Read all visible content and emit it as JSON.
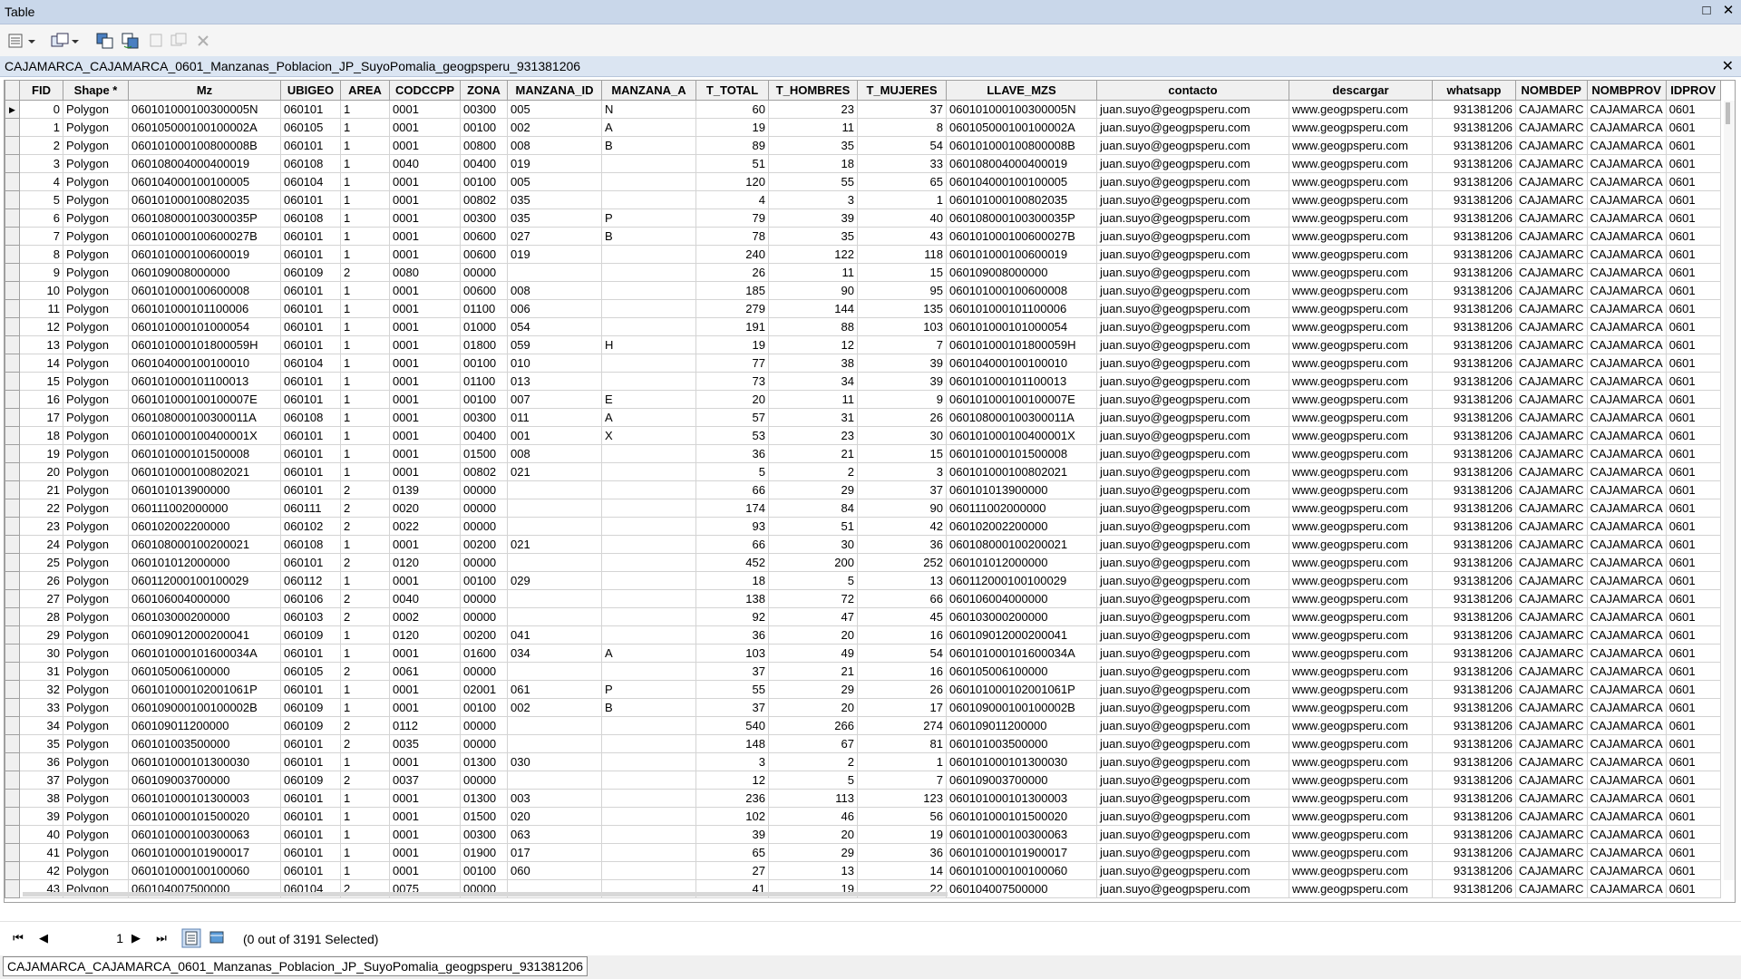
{
  "window": {
    "title": "Table",
    "maximize_icon": "maximize-icon",
    "close_icon": "close-icon"
  },
  "toolbar": {
    "icons": [
      "table-options-icon",
      "related-tables-icon",
      "select-by-attributes-icon",
      "switch-selection-icon",
      "clear-selection-icon",
      "zoom-to-selected-icon",
      "delete-selected-icon"
    ]
  },
  "tab": {
    "title": "CAJAMARCA_CAJAMARCA_0601_Manzanas_Poblacion_JP_SuyoPomalia_geogpsperu_931381206"
  },
  "grid": {
    "columns": [
      "FID",
      "Shape *",
      "Mz",
      "UBIGEO",
      "AREA",
      "CODCCPP",
      "ZONA",
      "MANZANA_ID",
      "MANZANA_A",
      "T_TOTAL",
      "T_HOMBRES",
      "T_MUJERES",
      "LLAVE_MZS",
      "contacto",
      "descargar",
      "whatsapp",
      "NOMBDEP",
      "NOMBPROV",
      "IDPROV"
    ],
    "rows": [
      [
        "0",
        "Polygon",
        "060101000100300005N",
        "060101",
        "1",
        "0001",
        "00300",
        "005",
        "N",
        "60",
        "23",
        "37",
        "060101000100300005N",
        "juan.suyo@geogpsperu.com",
        "www.geogpsperu.com",
        "931381206",
        "CAJAMARC",
        "CAJAMARCA",
        "0601"
      ],
      [
        "1",
        "Polygon",
        "060105000100100002A",
        "060105",
        "1",
        "0001",
        "00100",
        "002",
        "A",
        "19",
        "11",
        "8",
        "060105000100100002A",
        "juan.suyo@geogpsperu.com",
        "www.geogpsperu.com",
        "931381206",
        "CAJAMARC",
        "CAJAMARCA",
        "0601"
      ],
      [
        "2",
        "Polygon",
        "060101000100800008B",
        "060101",
        "1",
        "0001",
        "00800",
        "008",
        "B",
        "89",
        "35",
        "54",
        "060101000100800008B",
        "juan.suyo@geogpsperu.com",
        "www.geogpsperu.com",
        "931381206",
        "CAJAMARC",
        "CAJAMARCA",
        "0601"
      ],
      [
        "3",
        "Polygon",
        "060108004000400019",
        "060108",
        "1",
        "0040",
        "00400",
        "019",
        "",
        "51",
        "18",
        "33",
        "060108004000400019",
        "juan.suyo@geogpsperu.com",
        "www.geogpsperu.com",
        "931381206",
        "CAJAMARC",
        "CAJAMARCA",
        "0601"
      ],
      [
        "4",
        "Polygon",
        "060104000100100005",
        "060104",
        "1",
        "0001",
        "00100",
        "005",
        "",
        "120",
        "55",
        "65",
        "060104000100100005",
        "juan.suyo@geogpsperu.com",
        "www.geogpsperu.com",
        "931381206",
        "CAJAMARC",
        "CAJAMARCA",
        "0601"
      ],
      [
        "5",
        "Polygon",
        "060101000100802035",
        "060101",
        "1",
        "0001",
        "00802",
        "035",
        "",
        "4",
        "3",
        "1",
        "060101000100802035",
        "juan.suyo@geogpsperu.com",
        "www.geogpsperu.com",
        "931381206",
        "CAJAMARC",
        "CAJAMARCA",
        "0601"
      ],
      [
        "6",
        "Polygon",
        "060108000100300035P",
        "060108",
        "1",
        "0001",
        "00300",
        "035",
        "P",
        "79",
        "39",
        "40",
        "060108000100300035P",
        "juan.suyo@geogpsperu.com",
        "www.geogpsperu.com",
        "931381206",
        "CAJAMARC",
        "CAJAMARCA",
        "0601"
      ],
      [
        "7",
        "Polygon",
        "060101000100600027B",
        "060101",
        "1",
        "0001",
        "00600",
        "027",
        "B",
        "78",
        "35",
        "43",
        "060101000100600027B",
        "juan.suyo@geogpsperu.com",
        "www.geogpsperu.com",
        "931381206",
        "CAJAMARC",
        "CAJAMARCA",
        "0601"
      ],
      [
        "8",
        "Polygon",
        "060101000100600019",
        "060101",
        "1",
        "0001",
        "00600",
        "019",
        "",
        "240",
        "122",
        "118",
        "060101000100600019",
        "juan.suyo@geogpsperu.com",
        "www.geogpsperu.com",
        "931381206",
        "CAJAMARC",
        "CAJAMARCA",
        "0601"
      ],
      [
        "9",
        "Polygon",
        "060109008000000",
        "060109",
        "2",
        "0080",
        "00000",
        "",
        "",
        "26",
        "11",
        "15",
        "060109008000000",
        "juan.suyo@geogpsperu.com",
        "www.geogpsperu.com",
        "931381206",
        "CAJAMARC",
        "CAJAMARCA",
        "0601"
      ],
      [
        "10",
        "Polygon",
        "060101000100600008",
        "060101",
        "1",
        "0001",
        "00600",
        "008",
        "",
        "185",
        "90",
        "95",
        "060101000100600008",
        "juan.suyo@geogpsperu.com",
        "www.geogpsperu.com",
        "931381206",
        "CAJAMARC",
        "CAJAMARCA",
        "0601"
      ],
      [
        "11",
        "Polygon",
        "060101000101100006",
        "060101",
        "1",
        "0001",
        "01100",
        "006",
        "",
        "279",
        "144",
        "135",
        "060101000101100006",
        "juan.suyo@geogpsperu.com",
        "www.geogpsperu.com",
        "931381206",
        "CAJAMARC",
        "CAJAMARCA",
        "0601"
      ],
      [
        "12",
        "Polygon",
        "060101000101000054",
        "060101",
        "1",
        "0001",
        "01000",
        "054",
        "",
        "191",
        "88",
        "103",
        "060101000101000054",
        "juan.suyo@geogpsperu.com",
        "www.geogpsperu.com",
        "931381206",
        "CAJAMARC",
        "CAJAMARCA",
        "0601"
      ],
      [
        "13",
        "Polygon",
        "060101000101800059H",
        "060101",
        "1",
        "0001",
        "01800",
        "059",
        "H",
        "19",
        "12",
        "7",
        "060101000101800059H",
        "juan.suyo@geogpsperu.com",
        "www.geogpsperu.com",
        "931381206",
        "CAJAMARC",
        "CAJAMARCA",
        "0601"
      ],
      [
        "14",
        "Polygon",
        "060104000100100010",
        "060104",
        "1",
        "0001",
        "00100",
        "010",
        "",
        "77",
        "38",
        "39",
        "060104000100100010",
        "juan.suyo@geogpsperu.com",
        "www.geogpsperu.com",
        "931381206",
        "CAJAMARC",
        "CAJAMARCA",
        "0601"
      ],
      [
        "15",
        "Polygon",
        "060101000101100013",
        "060101",
        "1",
        "0001",
        "01100",
        "013",
        "",
        "73",
        "34",
        "39",
        "060101000101100013",
        "juan.suyo@geogpsperu.com",
        "www.geogpsperu.com",
        "931381206",
        "CAJAMARC",
        "CAJAMARCA",
        "0601"
      ],
      [
        "16",
        "Polygon",
        "060101000100100007E",
        "060101",
        "1",
        "0001",
        "00100",
        "007",
        "E",
        "20",
        "11",
        "9",
        "060101000100100007E",
        "juan.suyo@geogpsperu.com",
        "www.geogpsperu.com",
        "931381206",
        "CAJAMARC",
        "CAJAMARCA",
        "0601"
      ],
      [
        "17",
        "Polygon",
        "060108000100300011A",
        "060108",
        "1",
        "0001",
        "00300",
        "011",
        "A",
        "57",
        "31",
        "26",
        "060108000100300011A",
        "juan.suyo@geogpsperu.com",
        "www.geogpsperu.com",
        "931381206",
        "CAJAMARC",
        "CAJAMARCA",
        "0601"
      ],
      [
        "18",
        "Polygon",
        "060101000100400001X",
        "060101",
        "1",
        "0001",
        "00400",
        "001",
        "X",
        "53",
        "23",
        "30",
        "060101000100400001X",
        "juan.suyo@geogpsperu.com",
        "www.geogpsperu.com",
        "931381206",
        "CAJAMARC",
        "CAJAMARCA",
        "0601"
      ],
      [
        "19",
        "Polygon",
        "060101000101500008",
        "060101",
        "1",
        "0001",
        "01500",
        "008",
        "",
        "36",
        "21",
        "15",
        "060101000101500008",
        "juan.suyo@geogpsperu.com",
        "www.geogpsperu.com",
        "931381206",
        "CAJAMARC",
        "CAJAMARCA",
        "0601"
      ],
      [
        "20",
        "Polygon",
        "060101000100802021",
        "060101",
        "1",
        "0001",
        "00802",
        "021",
        "",
        "5",
        "2",
        "3",
        "060101000100802021",
        "juan.suyo@geogpsperu.com",
        "www.geogpsperu.com",
        "931381206",
        "CAJAMARC",
        "CAJAMARCA",
        "0601"
      ],
      [
        "21",
        "Polygon",
        "060101013900000",
        "060101",
        "2",
        "0139",
        "00000",
        "",
        "",
        "66",
        "29",
        "37",
        "060101013900000",
        "juan.suyo@geogpsperu.com",
        "www.geogpsperu.com",
        "931381206",
        "CAJAMARC",
        "CAJAMARCA",
        "0601"
      ],
      [
        "22",
        "Polygon",
        "060111002000000",
        "060111",
        "2",
        "0020",
        "00000",
        "",
        "",
        "174",
        "84",
        "90",
        "060111002000000",
        "juan.suyo@geogpsperu.com",
        "www.geogpsperu.com",
        "931381206",
        "CAJAMARC",
        "CAJAMARCA",
        "0601"
      ],
      [
        "23",
        "Polygon",
        "060102002200000",
        "060102",
        "2",
        "0022",
        "00000",
        "",
        "",
        "93",
        "51",
        "42",
        "060102002200000",
        "juan.suyo@geogpsperu.com",
        "www.geogpsperu.com",
        "931381206",
        "CAJAMARC",
        "CAJAMARCA",
        "0601"
      ],
      [
        "24",
        "Polygon",
        "060108000100200021",
        "060108",
        "1",
        "0001",
        "00200",
        "021",
        "",
        "66",
        "30",
        "36",
        "060108000100200021",
        "juan.suyo@geogpsperu.com",
        "www.geogpsperu.com",
        "931381206",
        "CAJAMARC",
        "CAJAMARCA",
        "0601"
      ],
      [
        "25",
        "Polygon",
        "060101012000000",
        "060101",
        "2",
        "0120",
        "00000",
        "",
        "",
        "452",
        "200",
        "252",
        "060101012000000",
        "juan.suyo@geogpsperu.com",
        "www.geogpsperu.com",
        "931381206",
        "CAJAMARC",
        "CAJAMARCA",
        "0601"
      ],
      [
        "26",
        "Polygon",
        "060112000100100029",
        "060112",
        "1",
        "0001",
        "00100",
        "029",
        "",
        "18",
        "5",
        "13",
        "060112000100100029",
        "juan.suyo@geogpsperu.com",
        "www.geogpsperu.com",
        "931381206",
        "CAJAMARC",
        "CAJAMARCA",
        "0601"
      ],
      [
        "27",
        "Polygon",
        "060106004000000",
        "060106",
        "2",
        "0040",
        "00000",
        "",
        "",
        "138",
        "72",
        "66",
        "060106004000000",
        "juan.suyo@geogpsperu.com",
        "www.geogpsperu.com",
        "931381206",
        "CAJAMARC",
        "CAJAMARCA",
        "0601"
      ],
      [
        "28",
        "Polygon",
        "060103000200000",
        "060103",
        "2",
        "0002",
        "00000",
        "",
        "",
        "92",
        "47",
        "45",
        "060103000200000",
        "juan.suyo@geogpsperu.com",
        "www.geogpsperu.com",
        "931381206",
        "CAJAMARC",
        "CAJAMARCA",
        "0601"
      ],
      [
        "29",
        "Polygon",
        "060109012000200041",
        "060109",
        "1",
        "0120",
        "00200",
        "041",
        "",
        "36",
        "20",
        "16",
        "060109012000200041",
        "juan.suyo@geogpsperu.com",
        "www.geogpsperu.com",
        "931381206",
        "CAJAMARC",
        "CAJAMARCA",
        "0601"
      ],
      [
        "30",
        "Polygon",
        "060101000101600034A",
        "060101",
        "1",
        "0001",
        "01600",
        "034",
        "A",
        "103",
        "49",
        "54",
        "060101000101600034A",
        "juan.suyo@geogpsperu.com",
        "www.geogpsperu.com",
        "931381206",
        "CAJAMARC",
        "CAJAMARCA",
        "0601"
      ],
      [
        "31",
        "Polygon",
        "060105006100000",
        "060105",
        "2",
        "0061",
        "00000",
        "",
        "",
        "37",
        "21",
        "16",
        "060105006100000",
        "juan.suyo@geogpsperu.com",
        "www.geogpsperu.com",
        "931381206",
        "CAJAMARC",
        "CAJAMARCA",
        "0601"
      ],
      [
        "32",
        "Polygon",
        "060101000102001061P",
        "060101",
        "1",
        "0001",
        "02001",
        "061",
        "P",
        "55",
        "29",
        "26",
        "060101000102001061P",
        "juan.suyo@geogpsperu.com",
        "www.geogpsperu.com",
        "931381206",
        "CAJAMARC",
        "CAJAMARCA",
        "0601"
      ],
      [
        "33",
        "Polygon",
        "060109000100100002B",
        "060109",
        "1",
        "0001",
        "00100",
        "002",
        "B",
        "37",
        "20",
        "17",
        "060109000100100002B",
        "juan.suyo@geogpsperu.com",
        "www.geogpsperu.com",
        "931381206",
        "CAJAMARC",
        "CAJAMARCA",
        "0601"
      ],
      [
        "34",
        "Polygon",
        "060109011200000",
        "060109",
        "2",
        "0112",
        "00000",
        "",
        "",
        "540",
        "266",
        "274",
        "060109011200000",
        "juan.suyo@geogpsperu.com",
        "www.geogpsperu.com",
        "931381206",
        "CAJAMARC",
        "CAJAMARCA",
        "0601"
      ],
      [
        "35",
        "Polygon",
        "060101003500000",
        "060101",
        "2",
        "0035",
        "00000",
        "",
        "",
        "148",
        "67",
        "81",
        "060101003500000",
        "juan.suyo@geogpsperu.com",
        "www.geogpsperu.com",
        "931381206",
        "CAJAMARC",
        "CAJAMARCA",
        "0601"
      ],
      [
        "36",
        "Polygon",
        "060101000101300030",
        "060101",
        "1",
        "0001",
        "01300",
        "030",
        "",
        "3",
        "2",
        "1",
        "060101000101300030",
        "juan.suyo@geogpsperu.com",
        "www.geogpsperu.com",
        "931381206",
        "CAJAMARC",
        "CAJAMARCA",
        "0601"
      ],
      [
        "37",
        "Polygon",
        "060109003700000",
        "060109",
        "2",
        "0037",
        "00000",
        "",
        "",
        "12",
        "5",
        "7",
        "060109003700000",
        "juan.suyo@geogpsperu.com",
        "www.geogpsperu.com",
        "931381206",
        "CAJAMARC",
        "CAJAMARCA",
        "0601"
      ],
      [
        "38",
        "Polygon",
        "060101000101300003",
        "060101",
        "1",
        "0001",
        "01300",
        "003",
        "",
        "236",
        "113",
        "123",
        "060101000101300003",
        "juan.suyo@geogpsperu.com",
        "www.geogpsperu.com",
        "931381206",
        "CAJAMARC",
        "CAJAMARCA",
        "0601"
      ],
      [
        "39",
        "Polygon",
        "060101000101500020",
        "060101",
        "1",
        "0001",
        "01500",
        "020",
        "",
        "102",
        "46",
        "56",
        "060101000101500020",
        "juan.suyo@geogpsperu.com",
        "www.geogpsperu.com",
        "931381206",
        "CAJAMARC",
        "CAJAMARCA",
        "0601"
      ],
      [
        "40",
        "Polygon",
        "060101000100300063",
        "060101",
        "1",
        "0001",
        "00300",
        "063",
        "",
        "39",
        "20",
        "19",
        "060101000100300063",
        "juan.suyo@geogpsperu.com",
        "www.geogpsperu.com",
        "931381206",
        "CAJAMARC",
        "CAJAMARCA",
        "0601"
      ],
      [
        "41",
        "Polygon",
        "060101000101900017",
        "060101",
        "1",
        "0001",
        "01900",
        "017",
        "",
        "65",
        "29",
        "36",
        "060101000101900017",
        "juan.suyo@geogpsperu.com",
        "www.geogpsperu.com",
        "931381206",
        "CAJAMARC",
        "CAJAMARCA",
        "0601"
      ],
      [
        "42",
        "Polygon",
        "060101000100100060",
        "060101",
        "1",
        "0001",
        "00100",
        "060",
        "",
        "27",
        "13",
        "14",
        "060101000100100060",
        "juan.suyo@geogpsperu.com",
        "www.geogpsperu.com",
        "931381206",
        "CAJAMARC",
        "CAJAMARCA",
        "0601"
      ],
      [
        "43",
        "Polygon",
        "060104007500000",
        "060104",
        "2",
        "0075",
        "00000",
        "",
        "",
        "41",
        "19",
        "22",
        "060104007500000",
        "juan.suyo@geogpsperu.com",
        "www.geogpsperu.com",
        "931381206",
        "CAJAMARC",
        "CAJAMARCA",
        "0601"
      ]
    ]
  },
  "navigation": {
    "page": "1",
    "selection_text": "(0 out of 3191 Selected)"
  },
  "status": {
    "tab_label": "CAJAMARCA_CAJAMARCA_0601_Manzanas_Poblacion_JP_SuyoPomalia_geogpsperu_931381206"
  }
}
